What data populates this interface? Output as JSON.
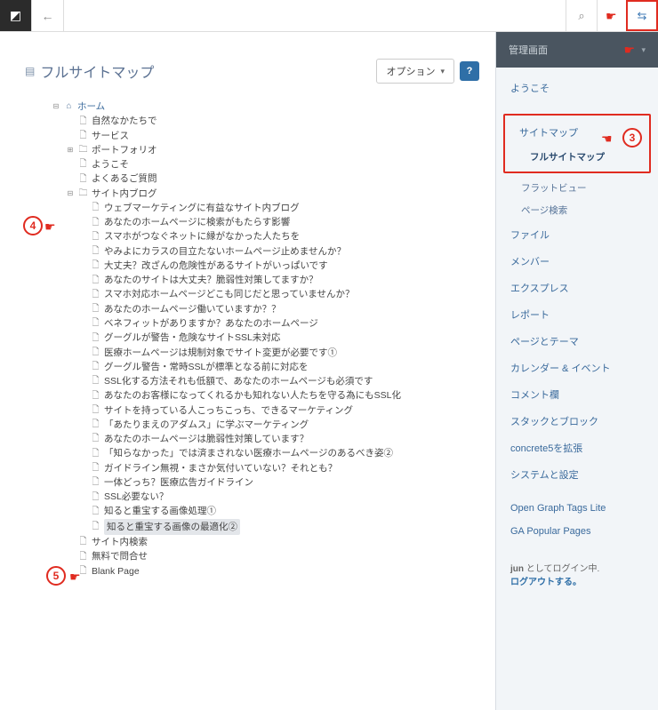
{
  "topbar": {
    "logo_glyph": "◩",
    "back_glyph": "←",
    "search_glyph": "⌕",
    "menu_glyph": "⇆"
  },
  "page": {
    "title": "フルサイトマップ",
    "options_label": "オプション",
    "help_glyph": "?"
  },
  "tree": {
    "root": {
      "label": "ホーム"
    },
    "children_l1": [
      {
        "icon": "page",
        "label": "自然なかたちで"
      },
      {
        "icon": "page",
        "label": "サービス"
      },
      {
        "icon": "folder",
        "label": "ポートフォリオ",
        "expandable": true
      },
      {
        "icon": "page",
        "label": "ようこそ"
      },
      {
        "icon": "page",
        "label": "よくあるご質問"
      },
      {
        "icon": "folder",
        "label": "サイト内ブログ",
        "expandable": true,
        "expanded": true
      },
      {
        "icon": "page",
        "label": "サイト内検索"
      },
      {
        "icon": "page",
        "label": "無料で問合せ"
      },
      {
        "icon": "page",
        "label": "Blank Page"
      }
    ],
    "blog_children": [
      "ウェブマーケティングに有益なサイト内ブログ",
      "あなたのホームページに検索がもたらす影響",
      "スマホがつなぐネットに縁がなかった人たちを",
      "やみよにカラスの目立たないホームページ止めませんか？",
      "大丈夫？改ざんの危険性があるサイトがいっぱいです",
      "あなたのサイトは大丈夫？脆弱性対策してますか？",
      "スマホ対応ホームページどこも同じだと思っていませんか？",
      "あなたのホームページ働いていますか？？",
      "ベネフィットがありますか？あなたのホームページ",
      "グーグルが警告・危険なサイトSSL未対応",
      "医療ホームページは規制対象でサイト変更が必要です①",
      "グーグル警告・常時SSLが標準となる前に対応を",
      "SSL化する方法それも低額で、あなたのホームページも必須です",
      "あなたのお客様になってくれるかも知れない人たちを守る為にもSSL化",
      "サイトを持っている人こっちこっち、できるマーケティング",
      "「あたりまえのアダムス」に学ぶマーケティング",
      "あなたのホームページは脆弱性対策しています？",
      "「知らなかった」では済まされない医療ホームページのあるべき姿②",
      "ガイドライン無視・まさか気付いていない？それとも？",
      "一体どっち？医療広告ガイドライン",
      "SSL必要ない？",
      "知ると重宝する画像処理①",
      "知ると重宝する画像の最適化②"
    ],
    "selected_index": 22
  },
  "sidebar": {
    "header": "管理画面",
    "items": [
      {
        "label": "ようこそ",
        "type": "item"
      },
      {
        "label": "サイトマップ",
        "type": "group",
        "children": [
          {
            "label": "フルサイトマップ",
            "active": true
          },
          {
            "label": "フラットビュー"
          },
          {
            "label": "ページ検索"
          }
        ]
      },
      {
        "label": "ファイル",
        "type": "item"
      },
      {
        "label": "メンバー",
        "type": "item"
      },
      {
        "label": "エクスプレス",
        "type": "item"
      },
      {
        "label": "レポート",
        "type": "item"
      },
      {
        "label": "ページとテーマ",
        "type": "item"
      },
      {
        "label": "カレンダー & イベント",
        "type": "item"
      },
      {
        "label": "コメント欄",
        "type": "item"
      },
      {
        "label": "スタックとブロック",
        "type": "item"
      },
      {
        "label": "concrete5を拡張",
        "type": "item"
      },
      {
        "label": "システムと設定",
        "type": "item"
      }
    ],
    "extra": [
      "Open Graph Tags Lite",
      "GA Popular Pages"
    ],
    "footer_user_prefix": "jun",
    "footer_user_suffix": " としてログイン中.",
    "footer_logout": "ログアウトする。"
  },
  "annotations": {
    "n3": "3",
    "n4": "4",
    "n5": "5"
  }
}
